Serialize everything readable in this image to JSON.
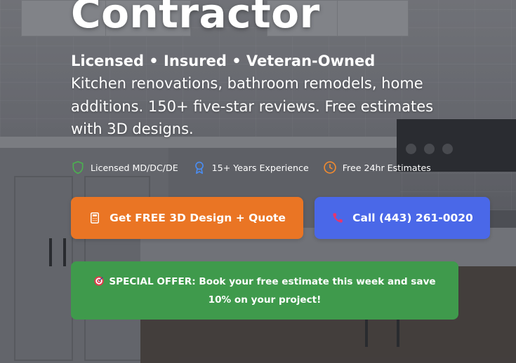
{
  "hero": {
    "title": "Contractor",
    "tagline": "Licensed • Insured • Veteran-Owned",
    "description": "Kitchen renovations, bathroom remodels, home additions. 150+ five-star reviews. Free estimates with 3D designs."
  },
  "badges": [
    {
      "icon": "shield-icon",
      "label": "Licensed MD/DC/DE",
      "color": "#4caf50"
    },
    {
      "icon": "award-ribbon-icon",
      "label": "15+ Years Experience",
      "color": "#4a8cf0"
    },
    {
      "icon": "clock-icon",
      "label": "Free 24hr Estimates",
      "color": "#f08a30"
    }
  ],
  "buttons": {
    "quote": {
      "label": "Get FREE 3D Design + Quote",
      "icon": "calculator-icon",
      "color": "#ea7524"
    },
    "call": {
      "label": "Call (443) 261-0020",
      "icon": "phone-icon",
      "color": "#4a68e8"
    }
  },
  "offer": {
    "icon": "target-icon",
    "text": "SPECIAL OFFER: Book your free estimate this week and save 10% on your project!",
    "color": "#3f9a4c"
  }
}
